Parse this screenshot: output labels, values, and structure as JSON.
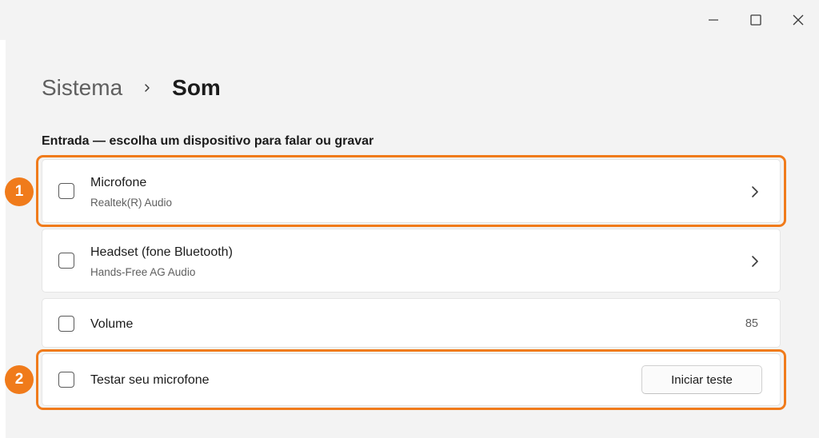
{
  "window": {
    "controls": {
      "minimize_icon": "minimize-icon",
      "maximize_icon": "maximize-icon",
      "close_icon": "close-icon"
    }
  },
  "breadcrumb": {
    "parent": "Sistema",
    "separator_icon": "chevron-right-icon",
    "current": "Som"
  },
  "input_section": {
    "title": "Entrada — escolha um dispositivo para falar ou gravar",
    "devices": [
      {
        "title": "Microfone",
        "subtitle": "Realtek(R) Audio"
      },
      {
        "title": "Headset (fone Bluetooth)",
        "subtitle": "Hands-Free AG Audio"
      }
    ],
    "volume": {
      "label": "Volume",
      "value": "85"
    },
    "test": {
      "label": "Testar seu microfone",
      "button_label": "Iniciar teste"
    }
  },
  "annotations": {
    "accent_color": "#f07b1b",
    "badges": [
      "1",
      "2"
    ]
  }
}
